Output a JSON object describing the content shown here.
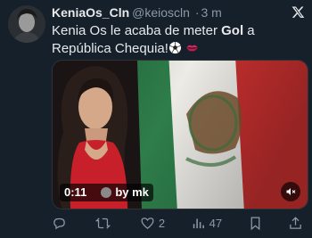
{
  "tweet": {
    "display_name": "KeniaOs_Cln",
    "handle": "@keioscln",
    "separator": "·",
    "time": "3 m",
    "text_before": "Kenia Os le acaba de meter ",
    "text_bold": "Gol",
    "text_after": " a República Chequia!"
  },
  "media": {
    "duration": "0:11",
    "credit": "by mk"
  },
  "actions": {
    "reply_count": "",
    "retweet_count": "",
    "like_count": "2",
    "views_count": "47"
  },
  "colors": {
    "background": "#15202b",
    "text": "#e7e9ea",
    "secondary": "#8b98a5",
    "flag_green": "#2e7d4a",
    "flag_red": "#c8302f"
  }
}
